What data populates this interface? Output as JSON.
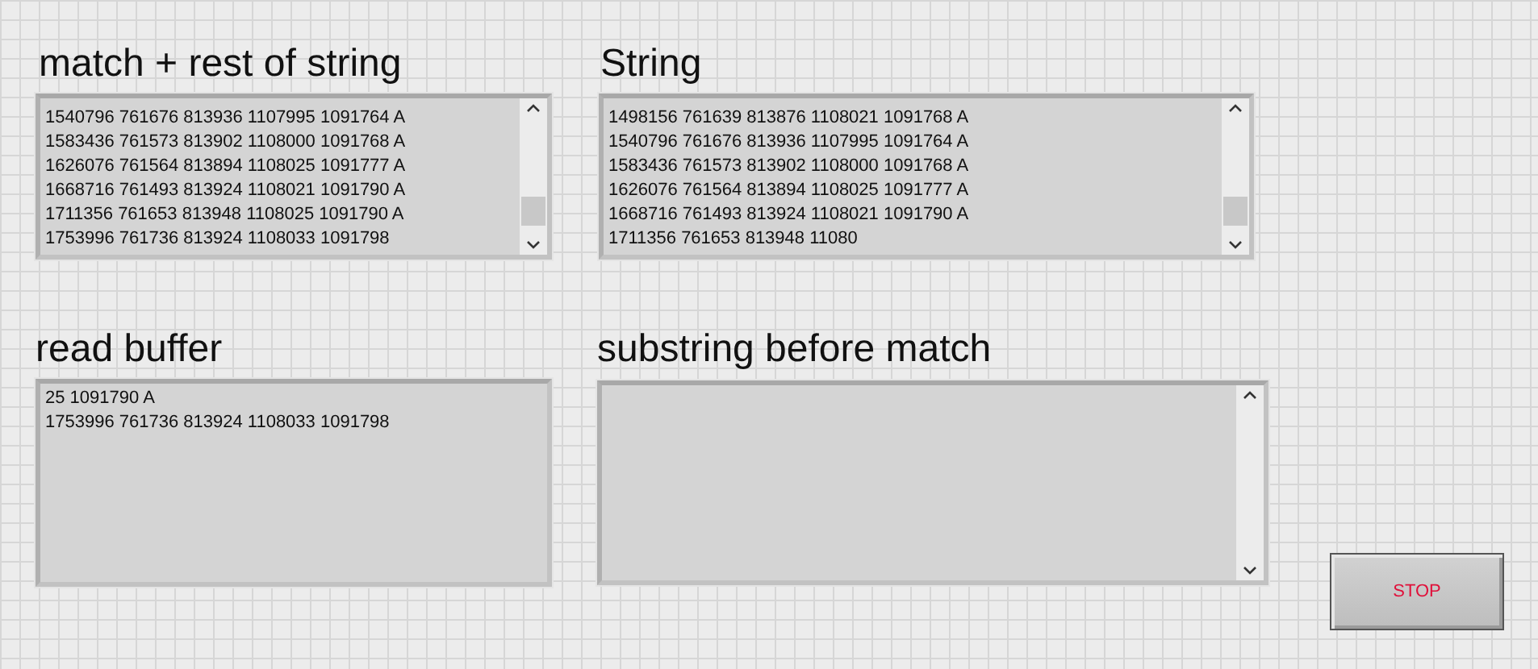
{
  "indicators": [
    {
      "label": "match + rest of string",
      "scrollbar": true,
      "lines": [
        "1540796 761676 813936 1107995 1091764 A",
        "1583436 761573 813902 1108000 1091768 A",
        "1626076 761564 813894 1108025 1091777 A",
        "1668716 761493 813924 1108021 1091790 A",
        "1711356 761653 813948 1108025 1091790 A",
        "1753996 761736 813924 1108033 1091798"
      ]
    },
    {
      "label": "String",
      "scrollbar": true,
      "lines": [
        "1498156 761639 813876 1108021 1091768 A",
        "1540796 761676 813936 1107995 1091764 A",
        "1583436 761573 813902 1108000 1091768 A",
        "1626076 761564 813894 1108025 1091777 A",
        "1668716 761493 813924 1108021 1091790 A",
        "1711356 761653 813948 11080"
      ]
    },
    {
      "label": "read buffer",
      "scrollbar": false,
      "lines": [
        "25 1091790 A",
        "1753996 761736 813924 1108033 1091798"
      ]
    },
    {
      "label": "substring before match",
      "scrollbar": true
    }
  ],
  "stop_button": {
    "label": "STOP"
  }
}
